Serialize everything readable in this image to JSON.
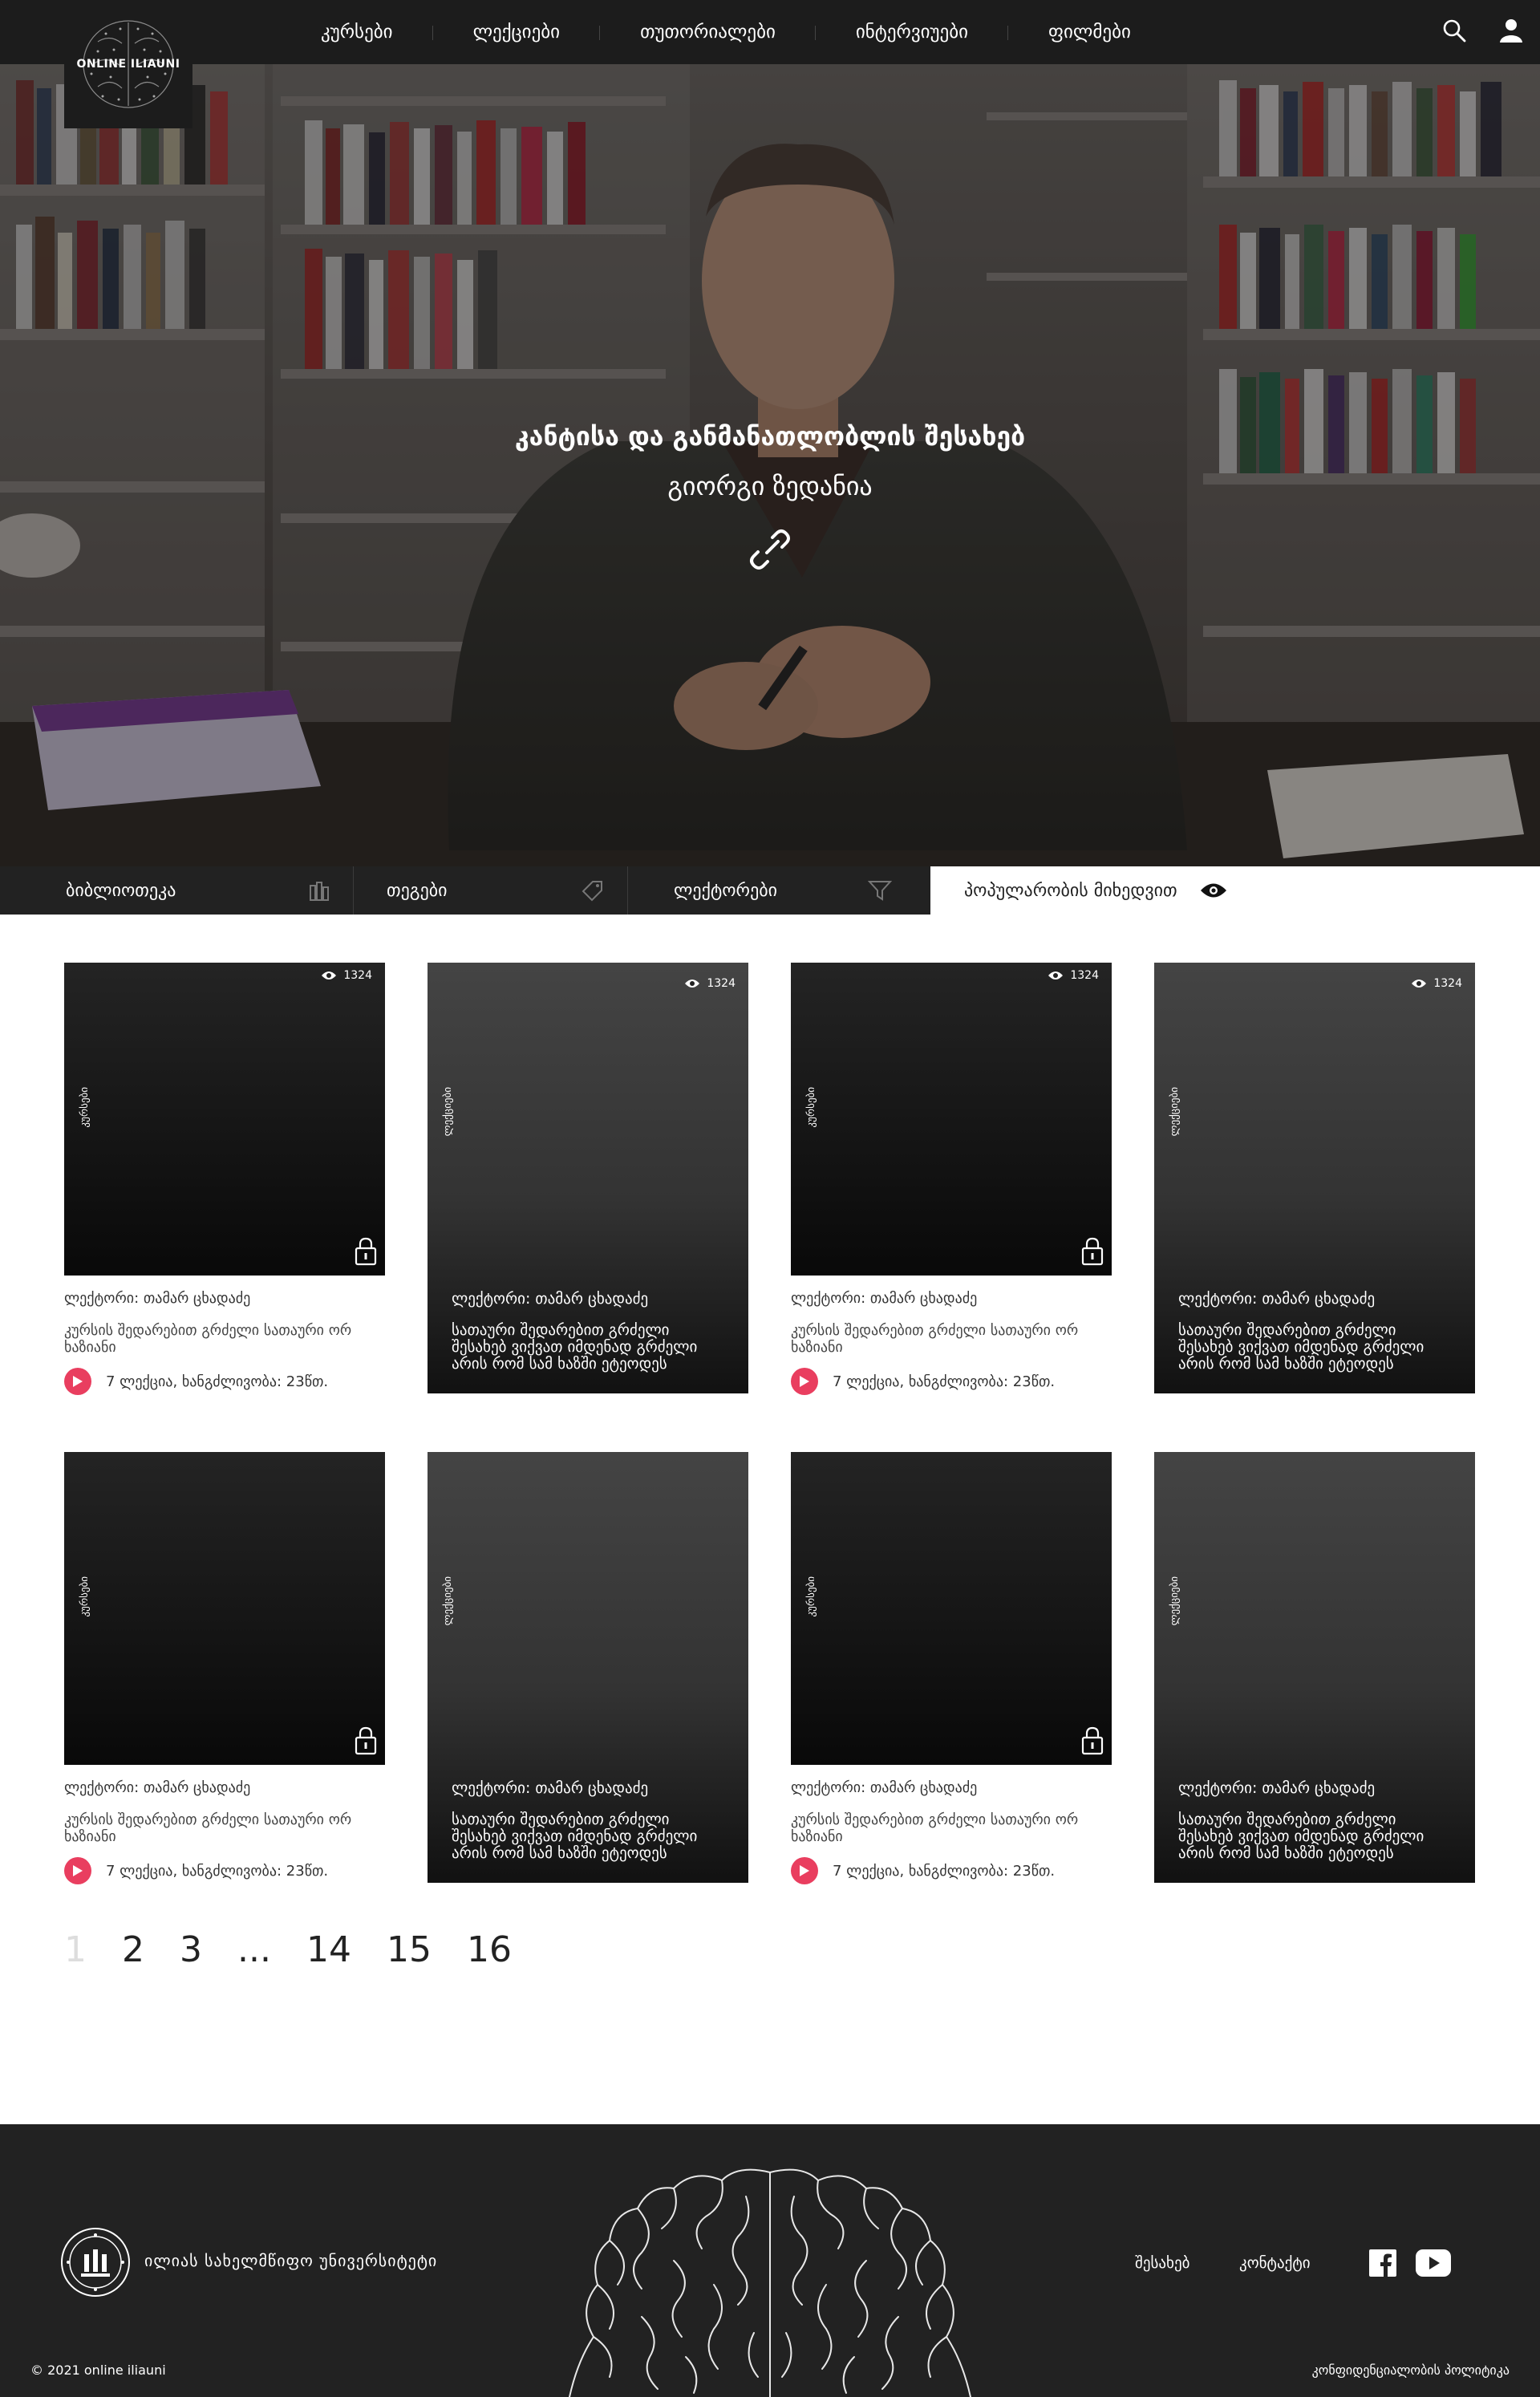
{
  "header": {
    "logo_text": "ONLINE ILIAUNI",
    "nav": [
      "კურსები",
      "ლექციები",
      "თუთორიალები",
      "ინტერვიუები",
      "ფილმები"
    ]
  },
  "hero": {
    "title": "კანტისა და განმანათლობლის შესახებ",
    "author": "გიორგი ზედანია"
  },
  "filters": {
    "library": "ბიბლიოთეკა",
    "tags": "თეგები",
    "lecturers": "ლექტორები",
    "sort": "პოპულარობის მიხედვით"
  },
  "cards": [
    {
      "type": "course",
      "label": "კურსები",
      "views": "1324",
      "lecturer": "ლექტორი: თამარ ცხადაძე",
      "title": "კურსის შედარებით გრძელი სათაური ორ ხაზიანი",
      "meta": "7 ლექცია, ხანგძლივობა: 23წთ."
    },
    {
      "type": "lecture",
      "label": "ლექციები",
      "views": "1324",
      "lecturer": "ლექტორი: თამარ ცხადაძე",
      "title": "სათაური შედარებით გრძელი შესახებ ვიქვათ იმდენად გრძელი არის რომ სამ ხაზში ეტეოდეს"
    },
    {
      "type": "course",
      "label": "კურსები",
      "views": "1324",
      "lecturer": "ლექტორი: თამარ ცხადაძე",
      "title": "კურსის შედარებით გრძელი სათაური ორ ხაზიანი",
      "meta": "7 ლექცია, ხანგძლივობა: 23წთ."
    },
    {
      "type": "lecture",
      "label": "ლექციები",
      "views": "1324",
      "lecturer": "ლექტორი: თამარ ცხადაძე",
      "title": "სათაური შედარებით გრძელი შესახებ ვიქვათ იმდენად გრძელი არის რომ სამ ხაზში ეტეოდეს"
    },
    {
      "type": "course",
      "label": "კურსები",
      "lecturer": "ლექტორი: თამარ ცხადაძე",
      "title": "კურსის შედარებით გრძელი სათაური ორ ხაზიანი",
      "meta": "7 ლექცია, ხანგძლივობა: 23წთ."
    },
    {
      "type": "lecture",
      "label": "ლექციები",
      "lecturer": "ლექტორი: თამარ ცხადაძე",
      "title": "სათაური შედარებით გრძელი შესახებ ვიქვათ იმდენად გრძელი არის რომ სამ ხაზში ეტეოდეს"
    },
    {
      "type": "course",
      "label": "კურსები",
      "lecturer": "ლექტორი: თამარ ცხადაძე",
      "title": "კურსის შედარებით გრძელი სათაური ორ ხაზიანი",
      "meta": "7 ლექცია, ხანგძლივობა: 23წთ."
    },
    {
      "type": "lecture",
      "label": "ლექციები",
      "lecturer": "ლექტორი: თამარ ცხადაძე",
      "title": "სათაური შედარებით გრძელი შესახებ ვიქვათ იმდენად გრძელი არის რომ სამ ხაზში ეტეოდეს"
    }
  ],
  "pagination": {
    "pages": [
      "1",
      "2",
      "3",
      "...",
      "14",
      "15",
      "16"
    ],
    "current": "1"
  },
  "footer": {
    "university": "ილიას სახელმწიფო უნივერსიტეტი",
    "about": "შესახებ",
    "contact": "კონტაქტი",
    "copyright": "© 2021 online iliauni",
    "privacy": "კონფიდენციალობის პოლიტიკა"
  },
  "colors": {
    "dark": "#222222",
    "accent": "#e93e5f",
    "header": "#1c1c1c"
  },
  "icons": [
    "search-icon",
    "user-icon",
    "link-icon",
    "library-icon",
    "tag-icon",
    "filter-icon",
    "eye-icon",
    "lock-icon",
    "play-icon",
    "facebook-icon",
    "youtube-icon"
  ]
}
